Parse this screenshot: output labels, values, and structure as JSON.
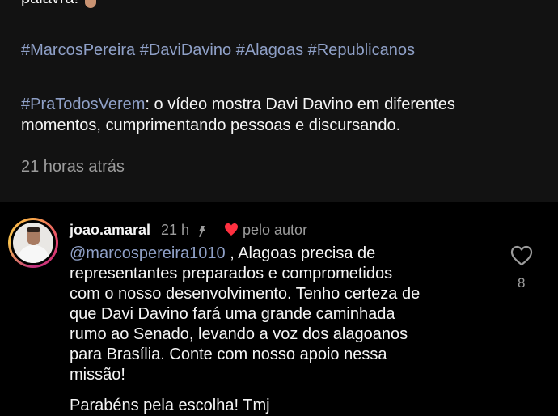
{
  "post": {
    "cut_off_line": "palavra!",
    "hashtags": [
      "#MarcosPereira",
      "#DaviDavino",
      "#Alagoas",
      "#Republicanos"
    ],
    "accessibility_tag": "#PraTodosVerem",
    "accessibility_text_1": ": o vídeo mostra Davi Davino em diferentes",
    "accessibility_text_2": "momentos, cumprimentando pessoas e discursando.",
    "timestamp": "21 horas atrás"
  },
  "comment": {
    "username": "joao.amaral",
    "time": "21 h",
    "liked_by_author_label": "pelo autor",
    "mention": "@marcospereira1010",
    "text_lines": [
      ", Alagoas precisa de",
      "representantes preparados e comprometidos",
      "com o nosso desenvolvimento. Tenho certeza de",
      "que Davi Davino fará uma grande caminhada",
      "rumo ao Senado, levando a voz dos alagoanos",
      "para Brasília. Conte com nosso apoio nessa",
      "missão!"
    ],
    "second_paragraph": "Parabéns pela escolha! Tmj",
    "like_count": "8"
  },
  "colors": {
    "caption_background": "#121212",
    "comment_background": "#000000",
    "hashtag_link": "#8fa0c7",
    "muted_text": "#9c9c9c",
    "liked_heart": "#ff3040"
  },
  "icons": {
    "pinned": "pin-icon",
    "liked_by_author": "heart-filled-icon",
    "like": "heart-outline-icon"
  }
}
